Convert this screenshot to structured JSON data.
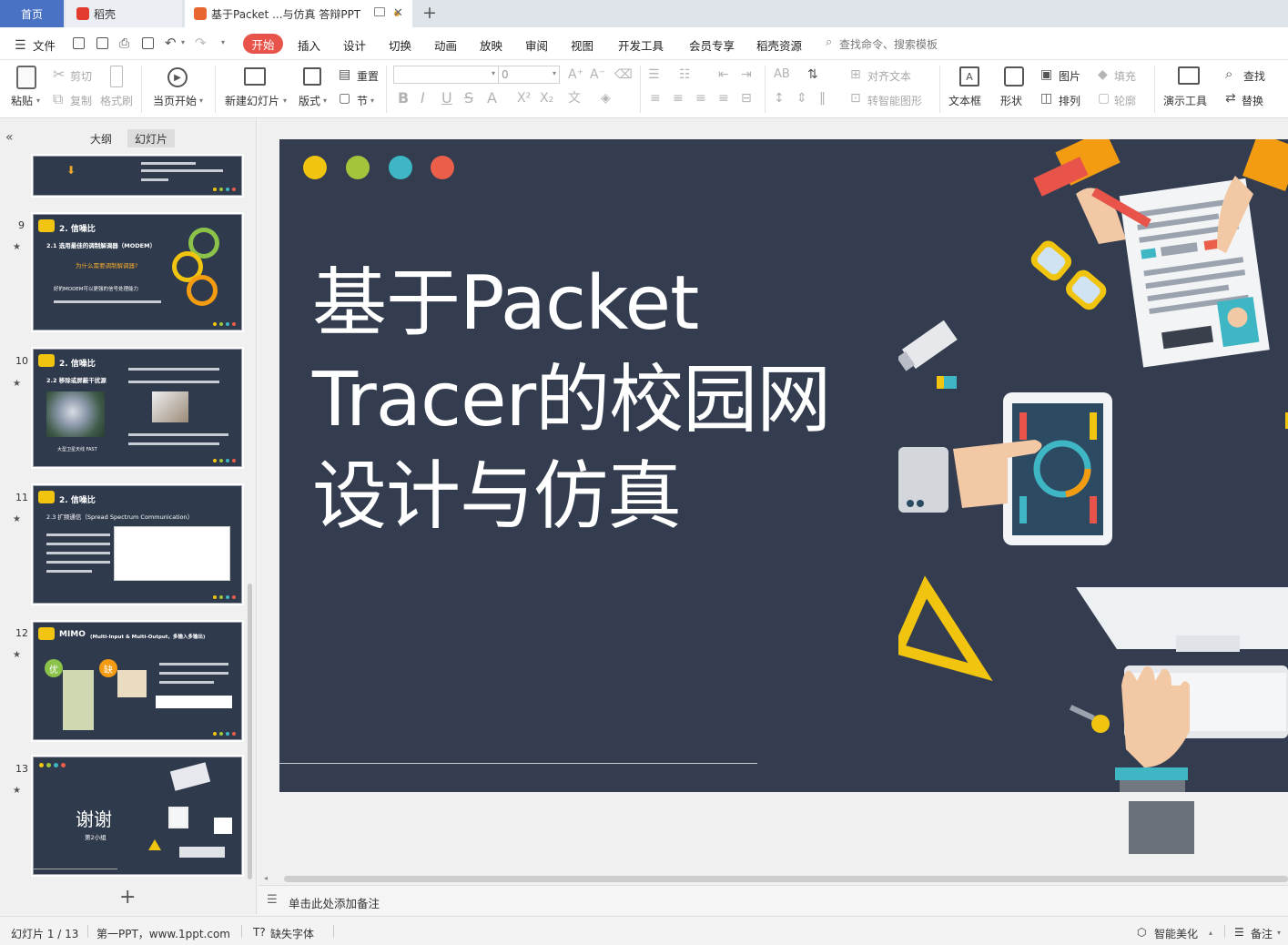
{
  "tabs": {
    "home": "首页",
    "daoke": "稻壳",
    "doc": "基于Packet ...与仿真 答辩PPT",
    "add": "+"
  },
  "menu": {
    "file": "文件",
    "items": [
      "开始",
      "插入",
      "设计",
      "切换",
      "动画",
      "放映",
      "审阅",
      "视图",
      "开发工具",
      "会员专享",
      "稻壳资源"
    ],
    "search": "查找命令、搜索模板"
  },
  "ribbon": {
    "paste": "粘贴",
    "cut": "剪切",
    "copy": "复制",
    "format_painter": "格式刷",
    "play_from_current": "当页开始",
    "new_slide": "新建幻灯片",
    "layout": "版式",
    "reset": "重置",
    "section": "节",
    "font_size": "0",
    "align_text": "对齐文本",
    "smart_shape": "转智能图形",
    "textbox": "文本框",
    "shape": "形状",
    "picture": "图片",
    "arrange": "排列",
    "fill": "填充",
    "outline": "轮廓",
    "presenter_tools": "演示工具",
    "find": "查找",
    "replace": "替换"
  },
  "left_panel": {
    "outline_tab": "大纲",
    "slides_tab": "幻灯片",
    "add": "+",
    "thumbs": [
      {
        "num": "9",
        "title": "2. 信噪比",
        "sub": "2.1 选用最佳的调制解调器（MODEM）",
        "q": "为什么需要调制解调器?",
        "body": "好的MODEM可以更强的信号处理能力"
      },
      {
        "num": "10",
        "title": "2. 信噪比",
        "sub": "2.2 移除或屏蔽干扰源",
        "caption": "大型卫星天线 FAST"
      },
      {
        "num": "11",
        "title": "2. 信噪比",
        "sub": "2.3 扩频通信（Spread Spectrum Communication）"
      },
      {
        "num": "12",
        "title": "MIMO",
        "sub": "(Multi-Input & Multi-Output，多输入多输出)",
        "pro": "优",
        "con": "缺"
      },
      {
        "num": "13",
        "title": "谢谢",
        "sub": "第2小组"
      }
    ]
  },
  "slide": {
    "title": "基于Packet Tracer的校园网设计与仿真",
    "dot_colors": [
      "#f1c40f",
      "#a3c43b",
      "#3fb6c4",
      "#ea5e4a"
    ]
  },
  "notes": {
    "placeholder": "单击此处添加备注"
  },
  "status": {
    "slide_counter": "幻灯片 1 / 13",
    "template": "第一PPT，www.1ppt.com",
    "missing_fonts": "缺失字体",
    "smart_beautify": "智能美化",
    "notes": "备注"
  },
  "colors": {
    "accent": "#e8544a",
    "slide_bg": "#333d4f",
    "home_tab": "#4a72c4"
  }
}
